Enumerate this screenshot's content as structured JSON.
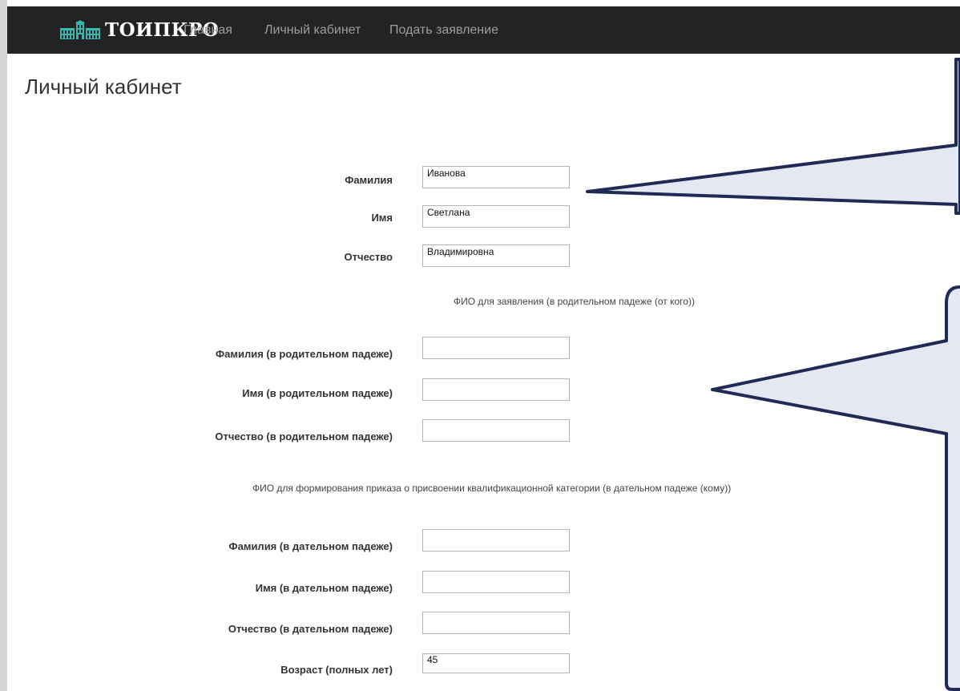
{
  "brand": {
    "name": "ТОИПКРО",
    "logo_icon": "building-icon"
  },
  "nav": {
    "items": [
      "Главная",
      "Личный кабинет",
      "Подать заявление"
    ]
  },
  "page": {
    "title": "Личный кабинет"
  },
  "form": {
    "name_fields": [
      {
        "label": "Фамилия",
        "value": "Иванова"
      },
      {
        "label": "Имя",
        "value": "Светлана"
      },
      {
        "label": "Отчество",
        "value": "Владимировна"
      }
    ],
    "genitive_heading": "ФИО для заявления (в родительном падеже (от кого))",
    "genitive_fields": [
      {
        "label": "Фамилия (в родительном падеже)",
        "value": ""
      },
      {
        "label": "Имя (в родительном падеже)",
        "value": ""
      },
      {
        "label": "Отчество (в родительном падеже)",
        "value": ""
      }
    ],
    "dative_heading": "ФИО для формирования приказа о присвоении квалификационной категории (в дательном падеже (кому))",
    "dative_fields": [
      {
        "label": "Фамилия (в дательном падеже)",
        "value": ""
      },
      {
        "label": "Имя (в дательном падеже)",
        "value": ""
      },
      {
        "label": "Отчество (в дательном падеже)",
        "value": ""
      }
    ],
    "age_field": {
      "label": "Возраст (полных лет)",
      "value": "45"
    }
  },
  "colors": {
    "navbar": "#232323",
    "nav_link": "#9d9d9d",
    "brand_logo": "#38b6b0",
    "callout_fill": "#e4e8f2",
    "callout_stroke": "#1f2a55"
  }
}
